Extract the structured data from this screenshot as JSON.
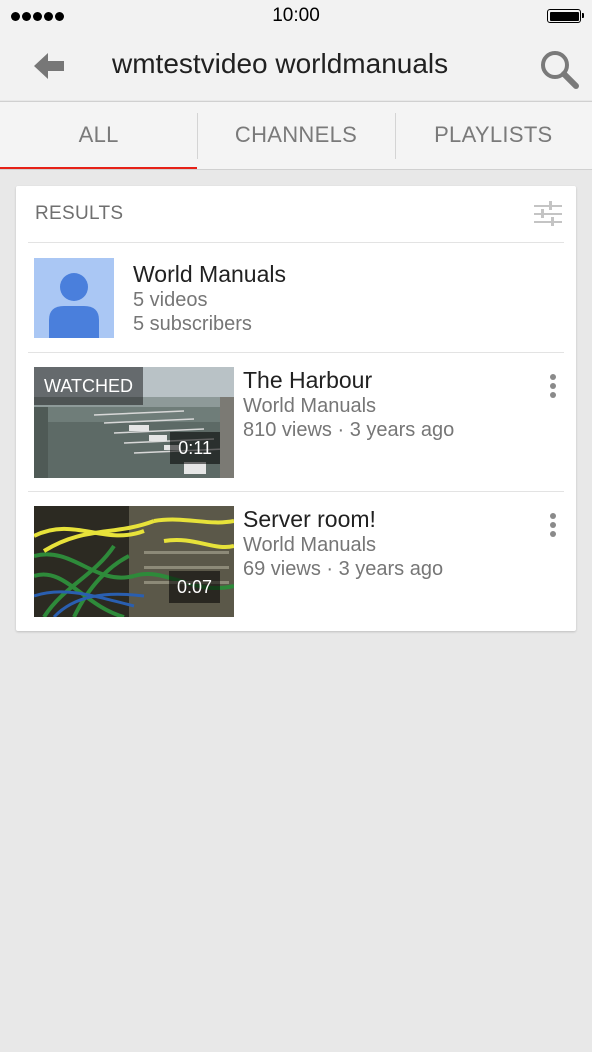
{
  "status_bar": {
    "time": "10:00"
  },
  "header": {
    "title": "wmtestvideo worldmanuals"
  },
  "icons": {
    "back": "back-arrow-icon",
    "search": "search-icon",
    "filter": "filter-sliders-icon",
    "more": "more-vert-icon"
  },
  "tabs": [
    {
      "label": "ALL",
      "active": true
    },
    {
      "label": "CHANNELS",
      "active": false
    },
    {
      "label": "PLAYLISTS",
      "active": false
    }
  ],
  "results": {
    "label": "RESULTS",
    "channel": {
      "name": "World Manuals",
      "videos": "5 videos",
      "subscribers": "5 subscribers"
    },
    "videos": [
      {
        "title": "The Harbour",
        "channel": "World Manuals",
        "meta": "810 views · 3 years ago",
        "duration": "0:11",
        "badge": "WATCHED"
      },
      {
        "title": "Server room!",
        "channel": "World Manuals",
        "meta": "69 views · 3 years ago",
        "duration": "0:07"
      }
    ]
  },
  "colors": {
    "accent": "#e62117",
    "avatar_bg": "#aac7f4",
    "avatar_fg": "#4a7fdc"
  }
}
